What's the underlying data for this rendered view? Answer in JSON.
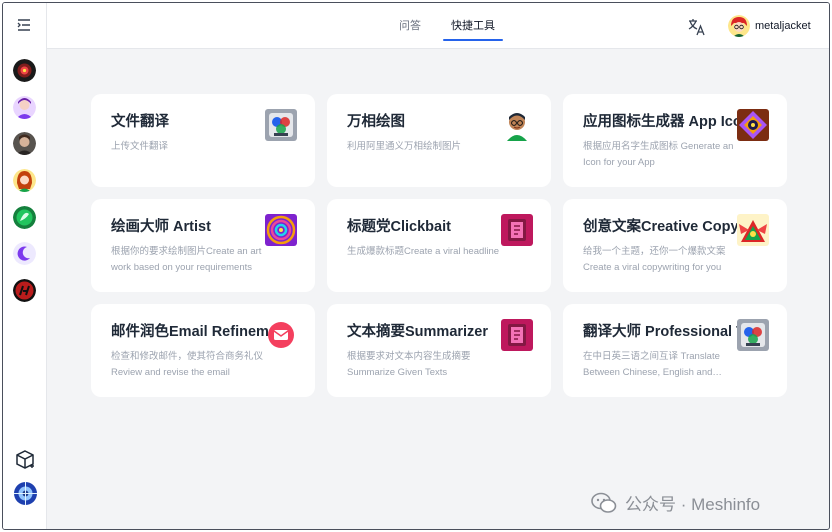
{
  "header": {
    "tabs": [
      {
        "label": "问答",
        "active": false
      },
      {
        "label": "快捷工具",
        "active": true
      }
    ],
    "translate_icon": "translate-icon",
    "user": {
      "name": "metaljacket"
    }
  },
  "sidebar": {
    "menu_icon": "menu-collapse-icon",
    "avatars": [
      {
        "name": "hal-eye-avatar",
        "color": "#b91c1c"
      },
      {
        "name": "woman-avatar",
        "color": "#a78bfa"
      },
      {
        "name": "portrait-avatar",
        "color": "#6b4f3a"
      },
      {
        "name": "girl-avatar",
        "color": "#d97706"
      },
      {
        "name": "leaf-avatar",
        "color": "#16a34a"
      },
      {
        "name": "moon-avatar",
        "color": "#7c3aed"
      },
      {
        "name": "hu-avatar",
        "color": "#dc2626"
      }
    ],
    "bottom_icons": [
      "package-icon",
      "user-avatar-icon"
    ]
  },
  "cards": [
    {
      "title": "文件翻译",
      "desc": "上传文件翻译",
      "icon": "document-translate-icon"
    },
    {
      "title": "万相绘图",
      "desc": "利用阿里通义万相绘制图片",
      "icon": "cartoon-boy-icon"
    },
    {
      "title": "应用图标生成器 App Icon Generator",
      "desc": "根据应用名字生成图标 Generate an Icon for your App",
      "icon": "app-icon-generator-icon"
    },
    {
      "title": "绘画大师 Artist",
      "desc": "根据你的要求绘制图片Create an art work based on your requirements",
      "icon": "artist-spiral-icon"
    },
    {
      "title": "标题党Clickbait",
      "desc": "生成爆款标题Create a viral headline",
      "icon": "clickbait-book-icon"
    },
    {
      "title": "创意文案Creative Copywriting",
      "desc": "给我一个主题，还你一个爆款文案Create a viral copywriting for you",
      "icon": "creative-bird-icon"
    },
    {
      "title": "邮件润色Email Refinement",
      "desc": "检查和修改邮件，使其符合商务礼仪 Review and revise the email",
      "icon": "email-icon"
    },
    {
      "title": "文本摘要Summarizer",
      "desc": "根据要求对文本内容生成摘要 Summarize Given Texts",
      "icon": "summarizer-book-icon"
    },
    {
      "title": "翻译大师 Professional Translator",
      "desc": "在中日英三语之间互译 Translate Between Chinese, English and Japanese",
      "icon": "translator-icon"
    }
  ],
  "watermark": {
    "text": "公众号 · Meshinfo"
  }
}
